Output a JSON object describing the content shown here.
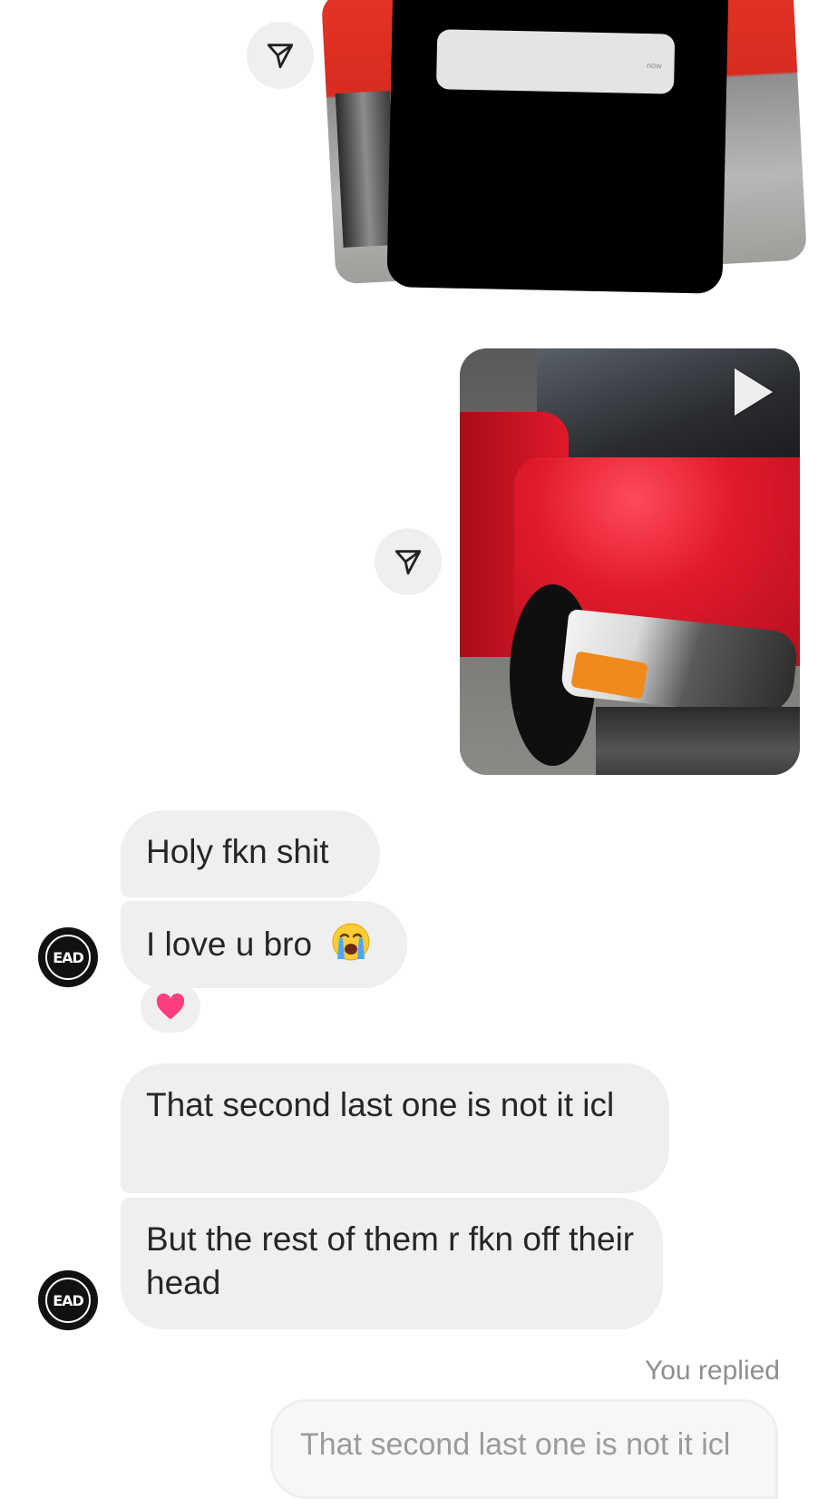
{
  "shared_media": [
    {
      "notification_time": "now"
    },
    {
      "type": "video"
    }
  ],
  "messages": [
    {
      "text": "Holy fkn shit"
    },
    {
      "text": "I love u bro",
      "emoji": "loudly-crying-face"
    },
    {
      "text": "That second last one is not it icl"
    },
    {
      "text": "But the rest of them r fkn off their head"
    }
  ],
  "reaction": {
    "emoji": "pink-heart"
  },
  "reply": {
    "label": "You replied",
    "quoted_text": "That second last one is not it icl"
  },
  "avatar": {
    "initials": "EAD"
  },
  "colors": {
    "bubble_bg": "#efefef",
    "text": "#262626",
    "muted": "#8e8e8e",
    "heart": "#ff3d7f"
  }
}
